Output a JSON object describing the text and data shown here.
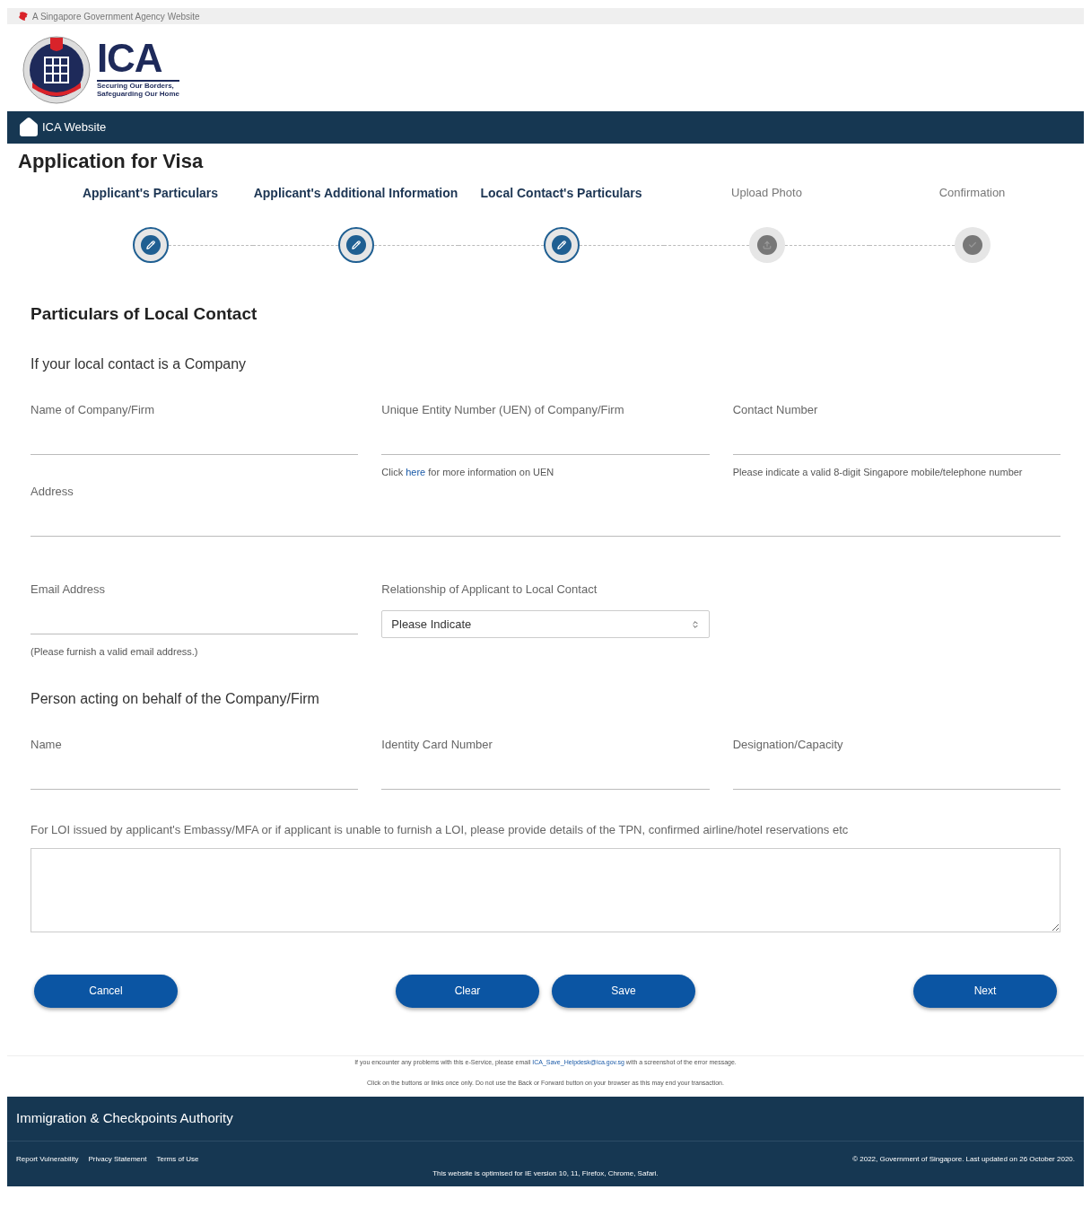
{
  "gov_banner": {
    "text": "A Singapore Government Agency Website"
  },
  "logo": {
    "name": "ICA",
    "tagline": [
      "Securing Our Borders,",
      "Safeguarding Our Home"
    ]
  },
  "nav": {
    "link": "ICA Website"
  },
  "page_title": "Application for Visa",
  "steps": [
    {
      "label": "Applicant's Particulars",
      "done": true
    },
    {
      "label": "Applicant's Additional Information",
      "done": true
    },
    {
      "label": "Local Contact's Particulars",
      "done": true
    },
    {
      "label": "Upload Photo",
      "done": false
    },
    {
      "label": "Confirmation",
      "done": false
    }
  ],
  "section_title": "Particulars of Local Contact",
  "company_heading": "If your local contact is a Company",
  "company_fields": [
    {
      "kind": "text",
      "label": "Name of Company/Firm"
    },
    {
      "kind": "text",
      "label": "Unique Entity Number (UEN) of Company/Firm",
      "hint": {
        "before": "Click ",
        "link": "here",
        "after": " for more information on UEN"
      }
    },
    {
      "kind": "text",
      "label": "Contact Number",
      "hint": {
        "before": "Please indicate a valid 8-digit Singapore mobile/telephone number"
      }
    }
  ],
  "address_field": {
    "kind": "text",
    "label": "Address"
  },
  "contact_fields": [
    {
      "kind": "text",
      "label": "Email Address",
      "hint": {
        "before": "(Please furnish a valid email address.)"
      }
    },
    {
      "kind": "select",
      "label": "Relationship of Applicant to Local Contact",
      "value": "Please Indicate"
    }
  ],
  "person_heading": "Person acting on behalf of the Company/Firm",
  "person_fields": [
    {
      "kind": "text",
      "label": "Name"
    },
    {
      "kind": "text",
      "label": "Identity Card Number"
    },
    {
      "kind": "text",
      "label": "Designation/Capacity"
    }
  ],
  "details_field": {
    "label": "For LOI issued by applicant's Embassy/MFA or if applicant is unable to furnish a LOI, please provide details of the TPN, confirmed airline/hotel reservations etc"
  },
  "buttons": [
    "Cancel",
    "Clear",
    "Save",
    "Next"
  ],
  "notes": [
    {
      "before": "If you encounter any problems with this e-Service, please email ",
      "link": "ICA_Save_Helpdesk@ica.gov.sg",
      "after": " with a screenshot of the error message."
    },
    {
      "before": "Click on the buttons or links once only. Do not use the Back or Forward button on your browser as this may end your transaction."
    }
  ],
  "footer": {
    "title": "Immigration & Checkpoints Authority",
    "links": [
      "Report Vulnerability",
      "Privacy Statement",
      "Terms of Use"
    ],
    "copyright": "© 2022, Government of Singapore. Last updated on 26 October 2020.",
    "browser_note": "This website is optimised for IE version 10, 11, Firefox, Chrome, Safari."
  }
}
